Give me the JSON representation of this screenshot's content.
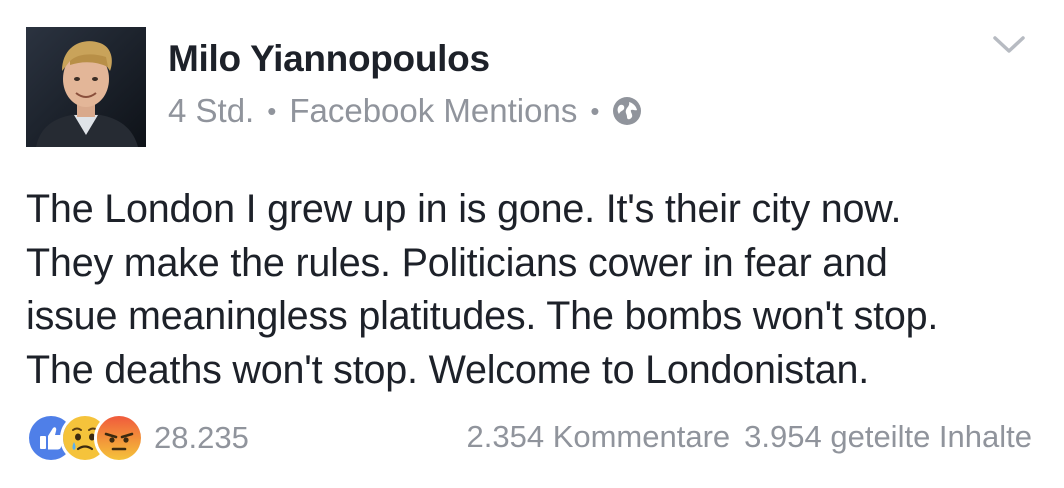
{
  "author": {
    "name": "Milo Yiannopoulos"
  },
  "meta": {
    "time": "4 Std.",
    "separator": "•",
    "source": "Facebook Mentions",
    "privacy_icon": "globe-icon"
  },
  "post": {
    "lines": [
      "The London I grew up in is gone. It's their city now.",
      "They make the rules. Politicians cower in fear and",
      "issue meaningless platitudes. The bombs won't stop.",
      "The deaths won't stop. Welcome to Londonistan."
    ]
  },
  "reactions": {
    "icons": [
      "like-icon",
      "sad-icon",
      "angry-icon"
    ],
    "count": "28.235"
  },
  "stats": {
    "comments": "2.354 Kommentare",
    "shares": "3.954 geteilte Inhalte"
  },
  "colors": {
    "like_blue": "#4f7fe8",
    "sad_yellow": "#f5c33b",
    "angry_red": "#f05a3c",
    "meta_gray": "#90949c",
    "text": "#1d2129"
  }
}
